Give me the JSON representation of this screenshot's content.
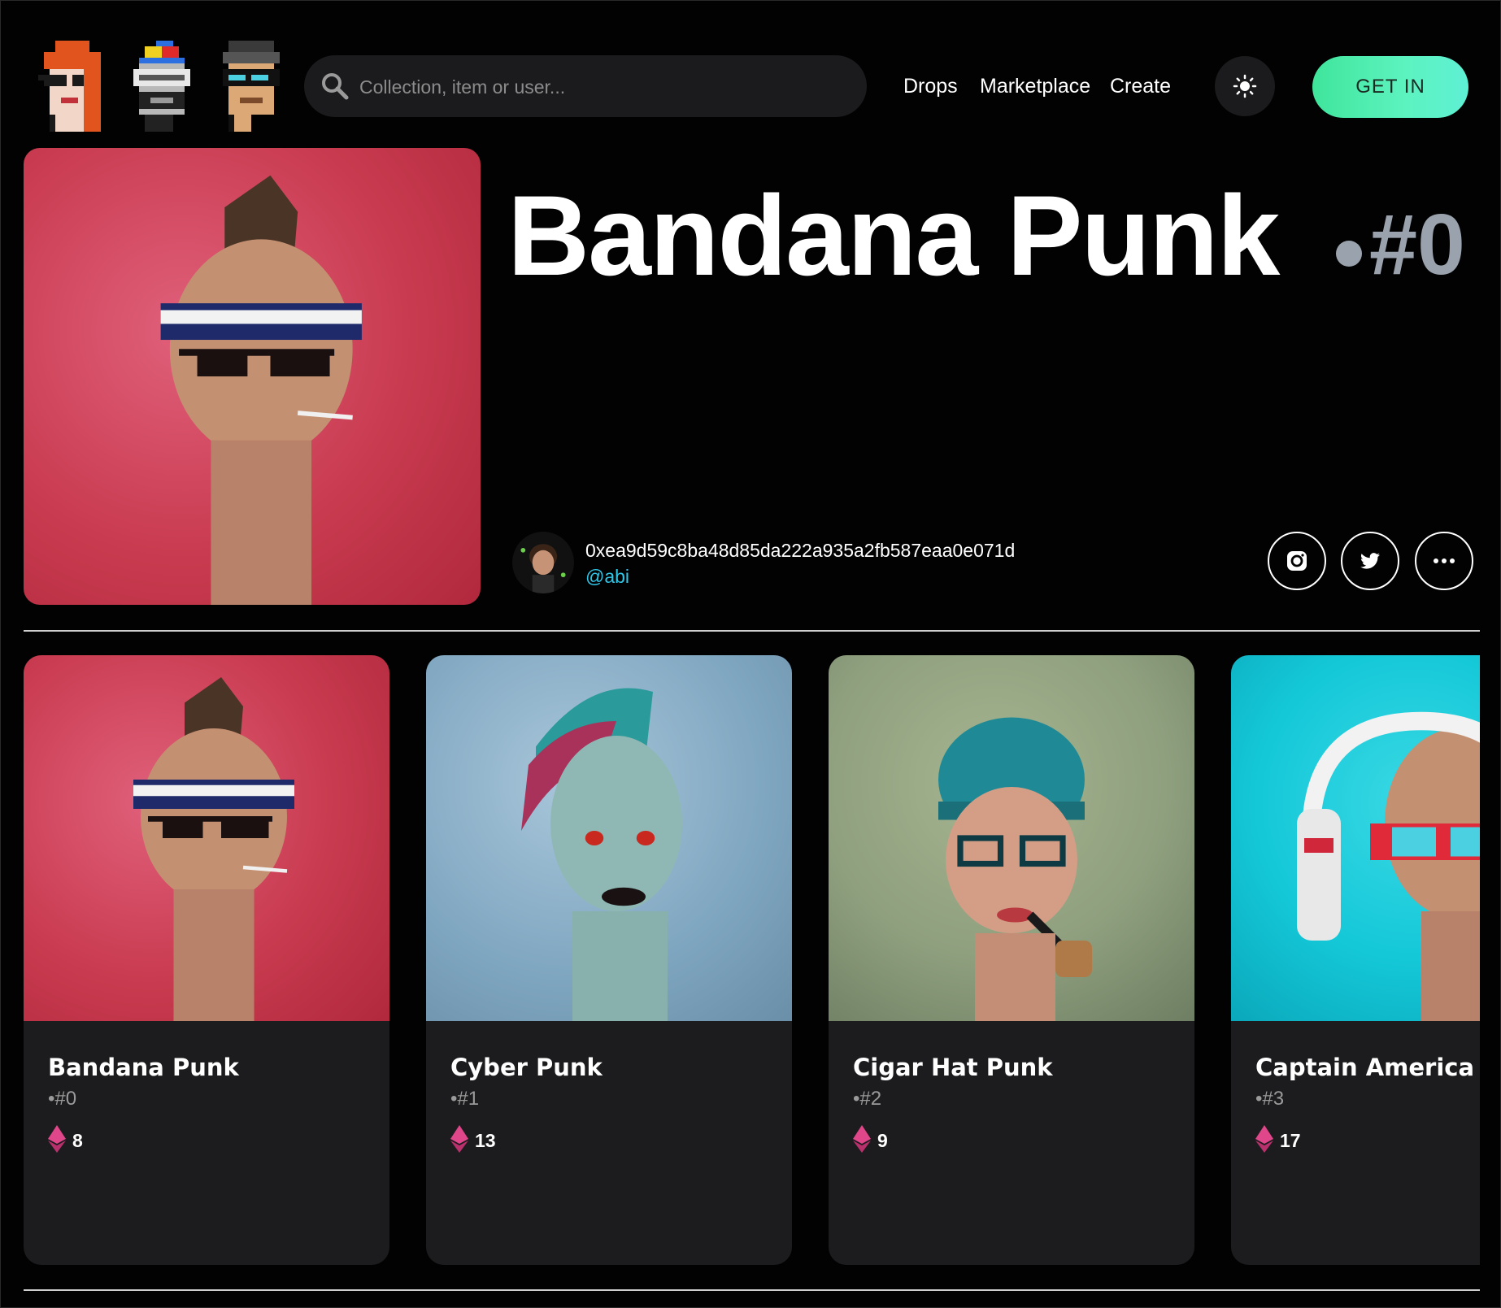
{
  "header": {
    "logos": [
      "punk-logo-orange-hair",
      "punk-logo-propeller-cap",
      "punk-logo-glasses"
    ],
    "search": {
      "placeholder": "Collection, item or user...",
      "value": ""
    },
    "nav": [
      {
        "label": "Drops"
      },
      {
        "label": "Marketplace"
      },
      {
        "label": "Create"
      }
    ],
    "theme_icon": "sun-icon",
    "cta_label": "GET IN"
  },
  "hero": {
    "title": "Bandana Punk",
    "token_id": "#0",
    "background": "#c93b50",
    "owner": {
      "address": "0xea9d59c8ba48d85da222a935a2fb587eaa0e071d",
      "handle": "@abi"
    },
    "actions": [
      "instagram-icon",
      "twitter-icon",
      "more-icon"
    ]
  },
  "cards": [
    {
      "name": "Bandana Punk",
      "id": "•#0",
      "price": "8",
      "background": "#c93b50"
    },
    {
      "name": "Cyber Punk",
      "id": "•#1",
      "price": "13",
      "background": "#7fa6c0"
    },
    {
      "name": "Cigar Hat Punk",
      "id": "•#2",
      "price": "9",
      "background": "#8fa07f"
    },
    {
      "name": "Captain America Punk",
      "id": "•#3",
      "price": "17",
      "background": "#14c8d8"
    }
  ],
  "colors": {
    "accent": "#3fe59b",
    "link": "#2fc6e8",
    "card_bg": "#1c1c1e",
    "eth": "#e0468a"
  }
}
